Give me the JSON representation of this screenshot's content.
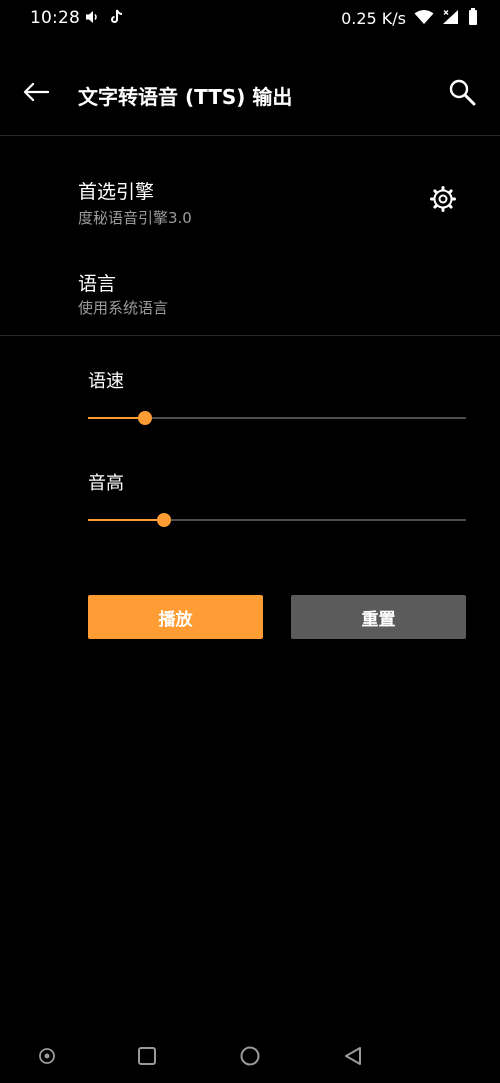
{
  "status_bar": {
    "time": "10:28",
    "net_speed": "0.25 K/s",
    "left_icons": [
      "mute-icon",
      "tiktok-icon"
    ],
    "right_icons": [
      "wifi-icon",
      "signal-icon",
      "battery-icon"
    ]
  },
  "app_bar": {
    "title": "文字转语音 (TTS) 输出",
    "back_icon": "back-arrow-icon",
    "search_icon": "search-icon"
  },
  "preferred_engine": {
    "title": "首选引擎",
    "summary": "度秘语音引擎3.0",
    "settings_icon": "gear-icon"
  },
  "language": {
    "title": "语言",
    "summary": "使用系统语言"
  },
  "speech_rate": {
    "label": "语速",
    "fraction": 0.15
  },
  "pitch": {
    "label": "音高",
    "fraction": 0.2
  },
  "buttons": {
    "play": "播放",
    "reset": "重置"
  },
  "colors": {
    "accent": "#ff9c33",
    "background": "#000000",
    "secondary_button": "#5b5b5b",
    "summary_text": "#9b9b9b"
  },
  "nav_bar": {
    "icons": [
      "nav-dot-icon",
      "recents-icon",
      "home-icon",
      "back-icon"
    ]
  }
}
